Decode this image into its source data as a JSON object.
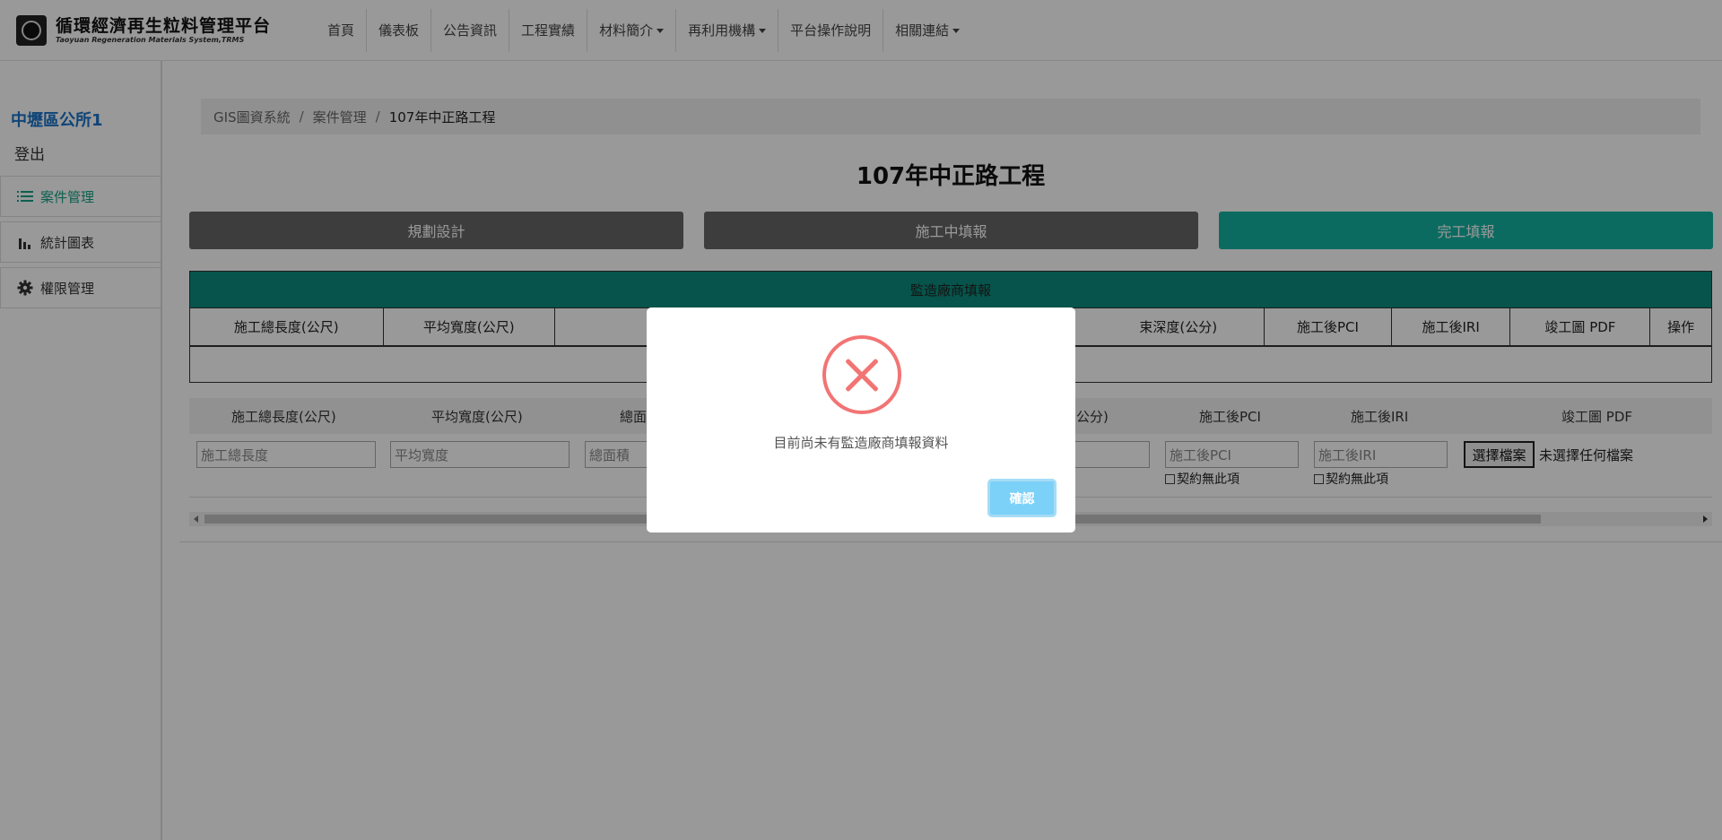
{
  "brand": {
    "title": "循環經濟再生粒料管理平台",
    "subtitle": "Taoyuan Regeneration Materials System,TRMS"
  },
  "nav": {
    "items": [
      {
        "label": "首頁",
        "dropdown": false
      },
      {
        "label": "儀表板",
        "dropdown": false
      },
      {
        "label": "公告資訊",
        "dropdown": false
      },
      {
        "label": "工程實績",
        "dropdown": false
      },
      {
        "label": "材料簡介",
        "dropdown": true
      },
      {
        "label": "再利用機構",
        "dropdown": true
      },
      {
        "label": "平台操作說明",
        "dropdown": false
      },
      {
        "label": "相關連結",
        "dropdown": true
      }
    ]
  },
  "sidebar": {
    "user": "中壢區公所1",
    "logout": "登出",
    "items": [
      {
        "label": "案件管理",
        "icon": "list-icon",
        "active": true
      },
      {
        "label": "統計圖表",
        "icon": "bar-chart-icon",
        "active": false
      },
      {
        "label": "權限管理",
        "icon": "gear-icon",
        "active": false
      }
    ]
  },
  "breadcrumb": {
    "items": [
      "GIS圖資系統",
      "案件管理",
      "107年中正路工程"
    ]
  },
  "page": {
    "title": "107年中正路工程"
  },
  "steps": {
    "items": [
      "規劃設計",
      "施工中填報",
      "完工填報"
    ]
  },
  "table": {
    "title": "監造廠商填報",
    "columns": [
      "施工總長度(公尺)",
      "平均寬度(公尺)",
      "",
      "",
      "束深度(公分)",
      "施工後PCI",
      "施工後IRI",
      "竣工圖 PDF",
      "操作"
    ]
  },
  "form": {
    "headers": [
      "施工總長度(公尺)",
      "平均寬度(公尺)",
      "總面",
      "公分)",
      "施工後PCI",
      "施工後IRI",
      "竣工圖 PDF"
    ],
    "placeholders": [
      "施工總長度",
      "平均寬度",
      "總面積",
      "施工後PCI",
      "施工後IRI"
    ],
    "checkbox_label": "契約無此項",
    "file_button": "選擇檔案",
    "file_status": "未選擇任何檔案"
  },
  "modal": {
    "message": "目前尚未有監造廠商填報資料",
    "confirm": "確認",
    "icon": "error-x-icon"
  },
  "colors": {
    "teal": "#14b3a0",
    "dark_teal": "#0b8c7d",
    "link_blue": "#1a73c8",
    "error_red": "#f27474",
    "confirm_blue": "#7cd1f9"
  }
}
